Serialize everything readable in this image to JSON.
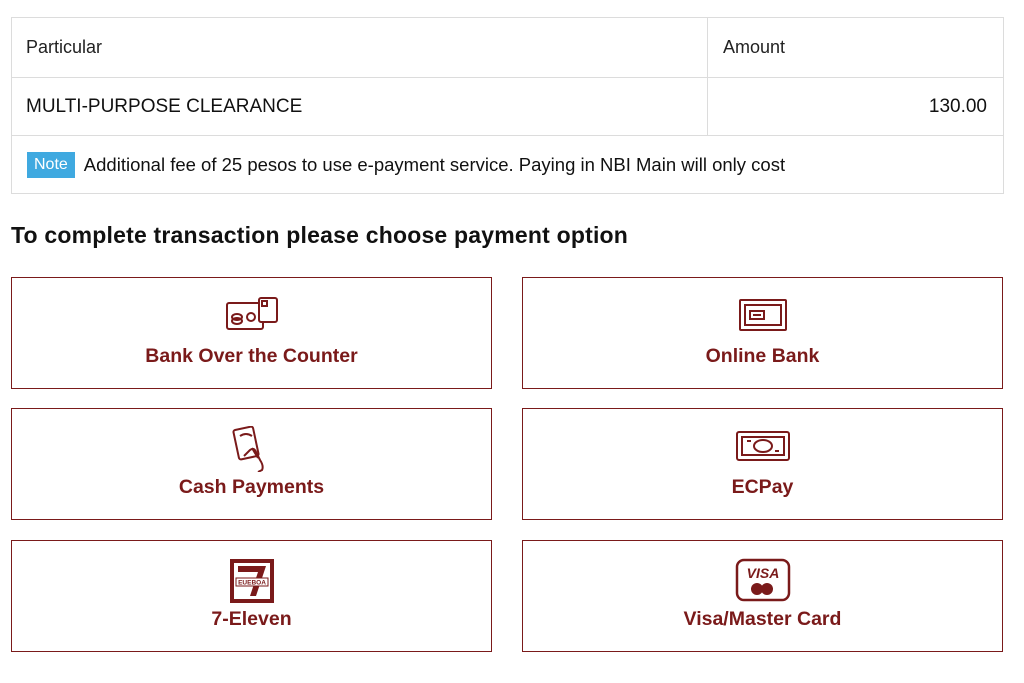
{
  "table": {
    "header": {
      "particular": "Particular",
      "amount": "Amount"
    },
    "items": [
      {
        "particular": "MULTI-PURPOSE CLEARANCE",
        "amount": "130.00"
      }
    ],
    "note": {
      "badge": "Note",
      "text": "Additional fee of 25 pesos to use e-payment service. Paying in NBI Main will only cost"
    }
  },
  "heading": "To complete transaction please choose payment option",
  "payment_options": [
    {
      "label": "Bank Over the Counter",
      "icon": "bank-card-icon"
    },
    {
      "label": "Online Bank",
      "icon": "online-bank-icon"
    },
    {
      "label": "Cash Payments",
      "icon": "cash-hand-icon"
    },
    {
      "label": "ECPay",
      "icon": "banknote-icon"
    },
    {
      "label": "7-Eleven",
      "icon": "seven-eleven-icon",
      "icon_text": "EUEBOA"
    },
    {
      "label": "Visa/Master Card",
      "icon": "visa-card-icon",
      "icon_text": "VISA"
    }
  ],
  "colors": {
    "accent": "#7a1a1a",
    "note_badge": "#3fa9e0",
    "border": "#dcdcdc"
  }
}
